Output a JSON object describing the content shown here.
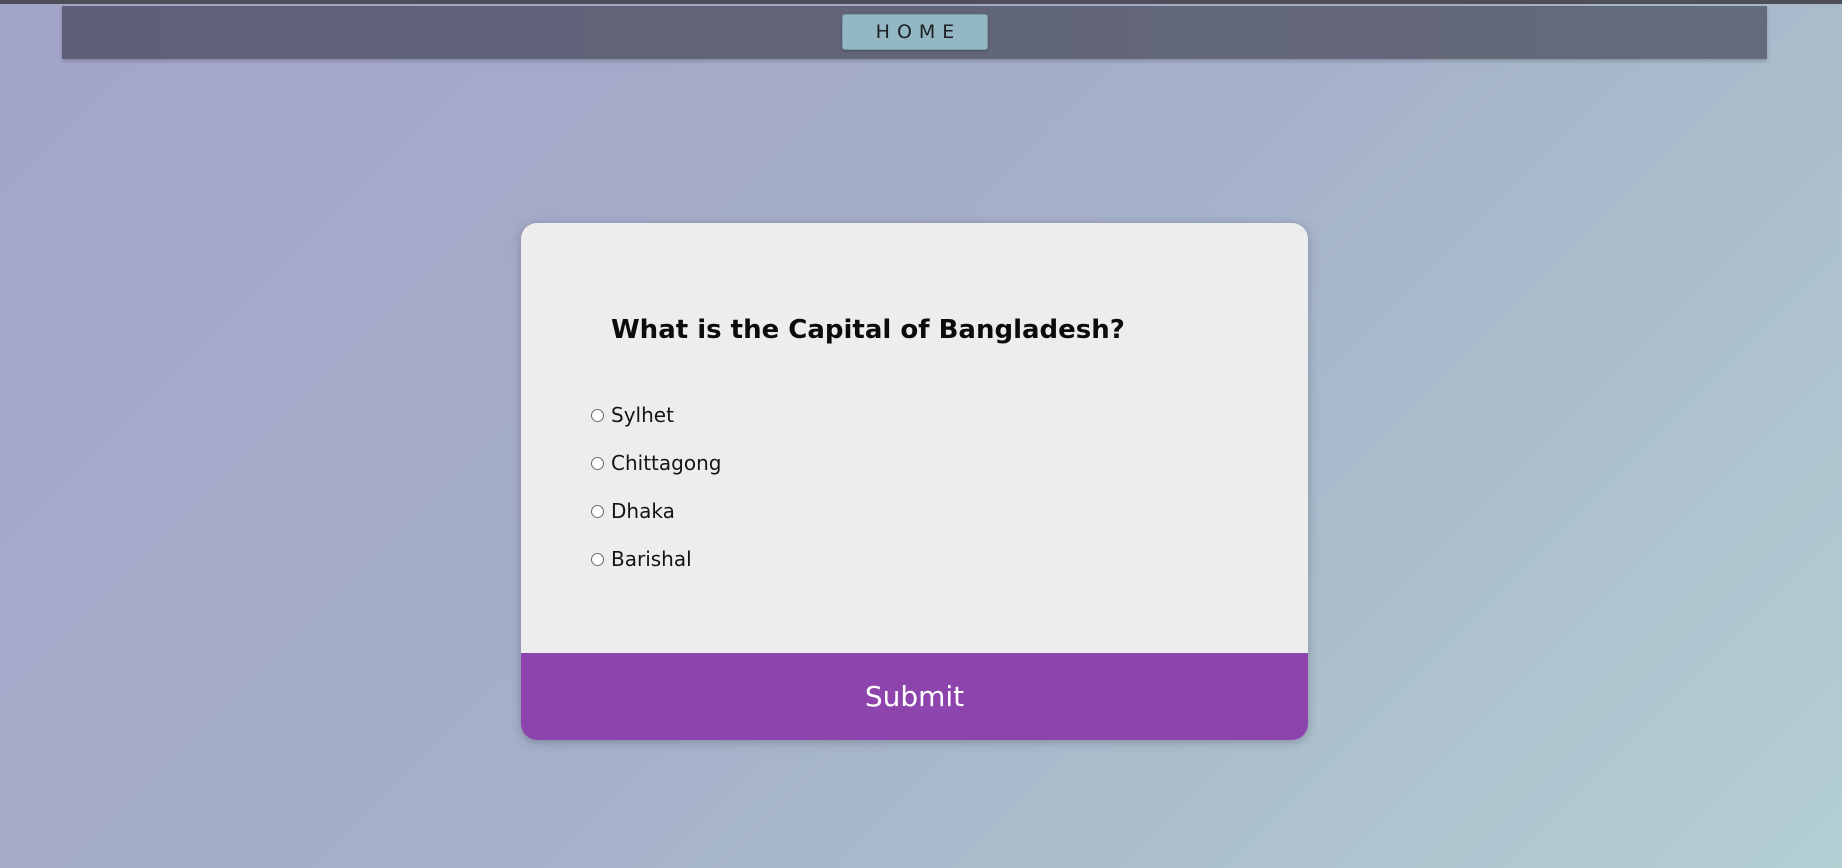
{
  "nav": {
    "home_label": "HOME"
  },
  "quiz": {
    "question": "What is the Capital of Bangladesh?",
    "options": [
      "Sylhet",
      "Chittagong",
      "Dhaka",
      "Barishal"
    ],
    "submit_label": "Submit"
  },
  "colors": {
    "submit_bg": "#8e44ad",
    "home_bg": "#93b7c3",
    "navbar_bg": "#616479",
    "card_bg": "#ededed"
  }
}
